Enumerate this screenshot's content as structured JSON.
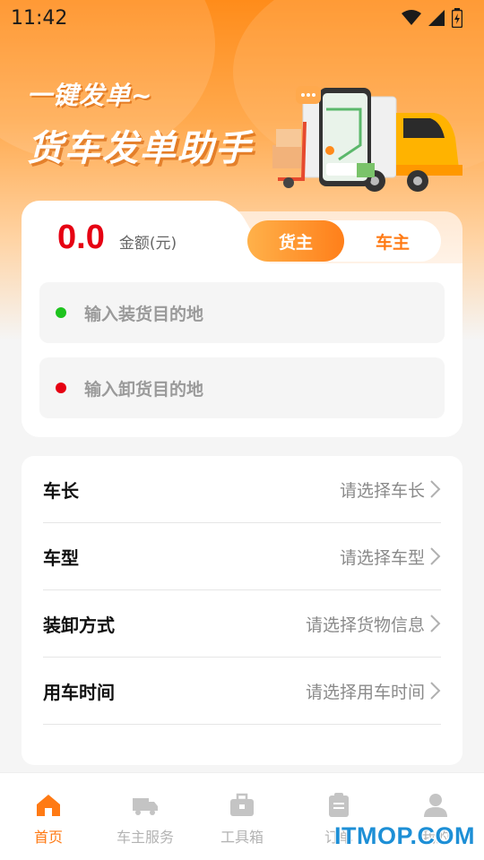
{
  "status_bar": {
    "time": "11:42",
    "icons": [
      "wifi-icon",
      "signal-icon",
      "battery-icon"
    ]
  },
  "banner": {
    "line1": "一键发单~",
    "line2": "货车发单助手",
    "illustration": "truck-phone-illustration"
  },
  "order_card": {
    "amount_value": "0.0",
    "amount_unit": "金额(元)",
    "roles": [
      {
        "label": "货主",
        "active": true
      },
      {
        "label": "车主",
        "active": false
      }
    ],
    "load_placeholder": "输入装货目的地",
    "unload_placeholder": "输入卸货目的地",
    "load_dot_color": "#1ec31e",
    "unload_dot_color": "#e60012"
  },
  "form": {
    "rows": [
      {
        "label": "车长",
        "placeholder": "请选择车长"
      },
      {
        "label": "车型",
        "placeholder": "请选择车型"
      },
      {
        "label": "装卸方式",
        "placeholder": "请选择货物信息"
      },
      {
        "label": "用车时间",
        "placeholder": "请选择用车时间"
      }
    ]
  },
  "tabbar": {
    "items": [
      {
        "label": "首页",
        "icon": "home-icon",
        "active": true
      },
      {
        "label": "车主服务",
        "icon": "truck-icon",
        "active": false
      },
      {
        "label": "工具箱",
        "icon": "toolbox-icon",
        "active": false
      },
      {
        "label": "订单",
        "icon": "clipboard-icon",
        "active": false
      },
      {
        "label": "我的",
        "icon": "user-icon",
        "active": false
      }
    ]
  },
  "watermark": "ITMOP.COM",
  "colors": {
    "accent": "#ff7a14",
    "amount": "#e60012"
  }
}
